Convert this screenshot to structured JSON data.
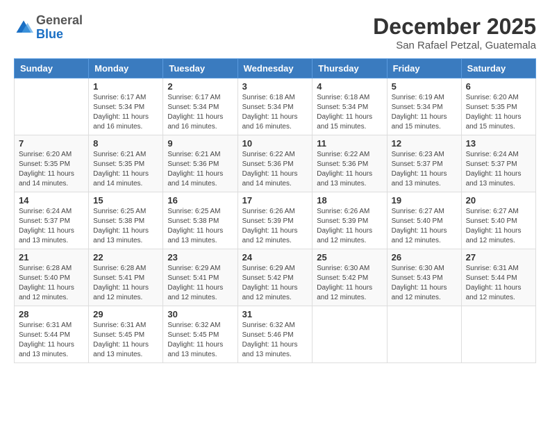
{
  "logo": {
    "general": "General",
    "blue": "Blue"
  },
  "title": "December 2025",
  "location": "San Rafael Petzal, Guatemala",
  "weekdays": [
    "Sunday",
    "Monday",
    "Tuesday",
    "Wednesday",
    "Thursday",
    "Friday",
    "Saturday"
  ],
  "weeks": [
    [
      {
        "day": "",
        "info": ""
      },
      {
        "day": "1",
        "info": "Sunrise: 6:17 AM\nSunset: 5:34 PM\nDaylight: 11 hours\nand 16 minutes."
      },
      {
        "day": "2",
        "info": "Sunrise: 6:17 AM\nSunset: 5:34 PM\nDaylight: 11 hours\nand 16 minutes."
      },
      {
        "day": "3",
        "info": "Sunrise: 6:18 AM\nSunset: 5:34 PM\nDaylight: 11 hours\nand 16 minutes."
      },
      {
        "day": "4",
        "info": "Sunrise: 6:18 AM\nSunset: 5:34 PM\nDaylight: 11 hours\nand 15 minutes."
      },
      {
        "day": "5",
        "info": "Sunrise: 6:19 AM\nSunset: 5:34 PM\nDaylight: 11 hours\nand 15 minutes."
      },
      {
        "day": "6",
        "info": "Sunrise: 6:20 AM\nSunset: 5:35 PM\nDaylight: 11 hours\nand 15 minutes."
      }
    ],
    [
      {
        "day": "7",
        "info": "Sunrise: 6:20 AM\nSunset: 5:35 PM\nDaylight: 11 hours\nand 14 minutes."
      },
      {
        "day": "8",
        "info": "Sunrise: 6:21 AM\nSunset: 5:35 PM\nDaylight: 11 hours\nand 14 minutes."
      },
      {
        "day": "9",
        "info": "Sunrise: 6:21 AM\nSunset: 5:36 PM\nDaylight: 11 hours\nand 14 minutes."
      },
      {
        "day": "10",
        "info": "Sunrise: 6:22 AM\nSunset: 5:36 PM\nDaylight: 11 hours\nand 14 minutes."
      },
      {
        "day": "11",
        "info": "Sunrise: 6:22 AM\nSunset: 5:36 PM\nDaylight: 11 hours\nand 13 minutes."
      },
      {
        "day": "12",
        "info": "Sunrise: 6:23 AM\nSunset: 5:37 PM\nDaylight: 11 hours\nand 13 minutes."
      },
      {
        "day": "13",
        "info": "Sunrise: 6:24 AM\nSunset: 5:37 PM\nDaylight: 11 hours\nand 13 minutes."
      }
    ],
    [
      {
        "day": "14",
        "info": "Sunrise: 6:24 AM\nSunset: 5:37 PM\nDaylight: 11 hours\nand 13 minutes."
      },
      {
        "day": "15",
        "info": "Sunrise: 6:25 AM\nSunset: 5:38 PM\nDaylight: 11 hours\nand 13 minutes."
      },
      {
        "day": "16",
        "info": "Sunrise: 6:25 AM\nSunset: 5:38 PM\nDaylight: 11 hours\nand 13 minutes."
      },
      {
        "day": "17",
        "info": "Sunrise: 6:26 AM\nSunset: 5:39 PM\nDaylight: 11 hours\nand 12 minutes."
      },
      {
        "day": "18",
        "info": "Sunrise: 6:26 AM\nSunset: 5:39 PM\nDaylight: 11 hours\nand 12 minutes."
      },
      {
        "day": "19",
        "info": "Sunrise: 6:27 AM\nSunset: 5:40 PM\nDaylight: 11 hours\nand 12 minutes."
      },
      {
        "day": "20",
        "info": "Sunrise: 6:27 AM\nSunset: 5:40 PM\nDaylight: 11 hours\nand 12 minutes."
      }
    ],
    [
      {
        "day": "21",
        "info": "Sunrise: 6:28 AM\nSunset: 5:40 PM\nDaylight: 11 hours\nand 12 minutes."
      },
      {
        "day": "22",
        "info": "Sunrise: 6:28 AM\nSunset: 5:41 PM\nDaylight: 11 hours\nand 12 minutes."
      },
      {
        "day": "23",
        "info": "Sunrise: 6:29 AM\nSunset: 5:41 PM\nDaylight: 11 hours\nand 12 minutes."
      },
      {
        "day": "24",
        "info": "Sunrise: 6:29 AM\nSunset: 5:42 PM\nDaylight: 11 hours\nand 12 minutes."
      },
      {
        "day": "25",
        "info": "Sunrise: 6:30 AM\nSunset: 5:42 PM\nDaylight: 11 hours\nand 12 minutes."
      },
      {
        "day": "26",
        "info": "Sunrise: 6:30 AM\nSunset: 5:43 PM\nDaylight: 11 hours\nand 12 minutes."
      },
      {
        "day": "27",
        "info": "Sunrise: 6:31 AM\nSunset: 5:44 PM\nDaylight: 11 hours\nand 12 minutes."
      }
    ],
    [
      {
        "day": "28",
        "info": "Sunrise: 6:31 AM\nSunset: 5:44 PM\nDaylight: 11 hours\nand 13 minutes."
      },
      {
        "day": "29",
        "info": "Sunrise: 6:31 AM\nSunset: 5:45 PM\nDaylight: 11 hours\nand 13 minutes."
      },
      {
        "day": "30",
        "info": "Sunrise: 6:32 AM\nSunset: 5:45 PM\nDaylight: 11 hours\nand 13 minutes."
      },
      {
        "day": "31",
        "info": "Sunrise: 6:32 AM\nSunset: 5:46 PM\nDaylight: 11 hours\nand 13 minutes."
      },
      {
        "day": "",
        "info": ""
      },
      {
        "day": "",
        "info": ""
      },
      {
        "day": "",
        "info": ""
      }
    ]
  ]
}
